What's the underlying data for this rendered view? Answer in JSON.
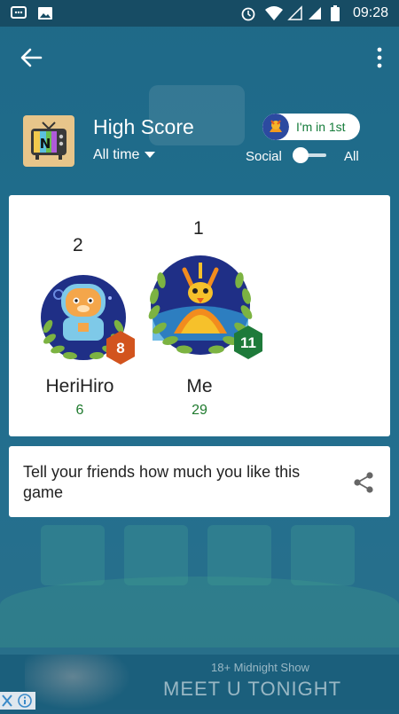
{
  "status_bar": {
    "time": "09:28"
  },
  "header": {
    "title": "High Score",
    "period": "All time",
    "rank_chip": "I'm in 1st",
    "toggle_left": "Social",
    "toggle_right": "All"
  },
  "leaderboard": {
    "players": [
      {
        "rank": "2",
        "name": "HeriHiro",
        "score": "6",
        "level": "8",
        "badge_color": "#d2541e"
      },
      {
        "rank": "1",
        "name": "Me",
        "score": "29",
        "level": "11",
        "badge_color": "#1e7a3a"
      }
    ]
  },
  "share": {
    "text": "Tell your friends how much you like this game"
  },
  "ad": {
    "tag": "18+ Midnight Show",
    "headline": "MEET U TONIGHT"
  },
  "colors": {
    "primary": "#1d5f7e",
    "score_green": "#1f7a2e",
    "chip_text": "#157c3a"
  }
}
